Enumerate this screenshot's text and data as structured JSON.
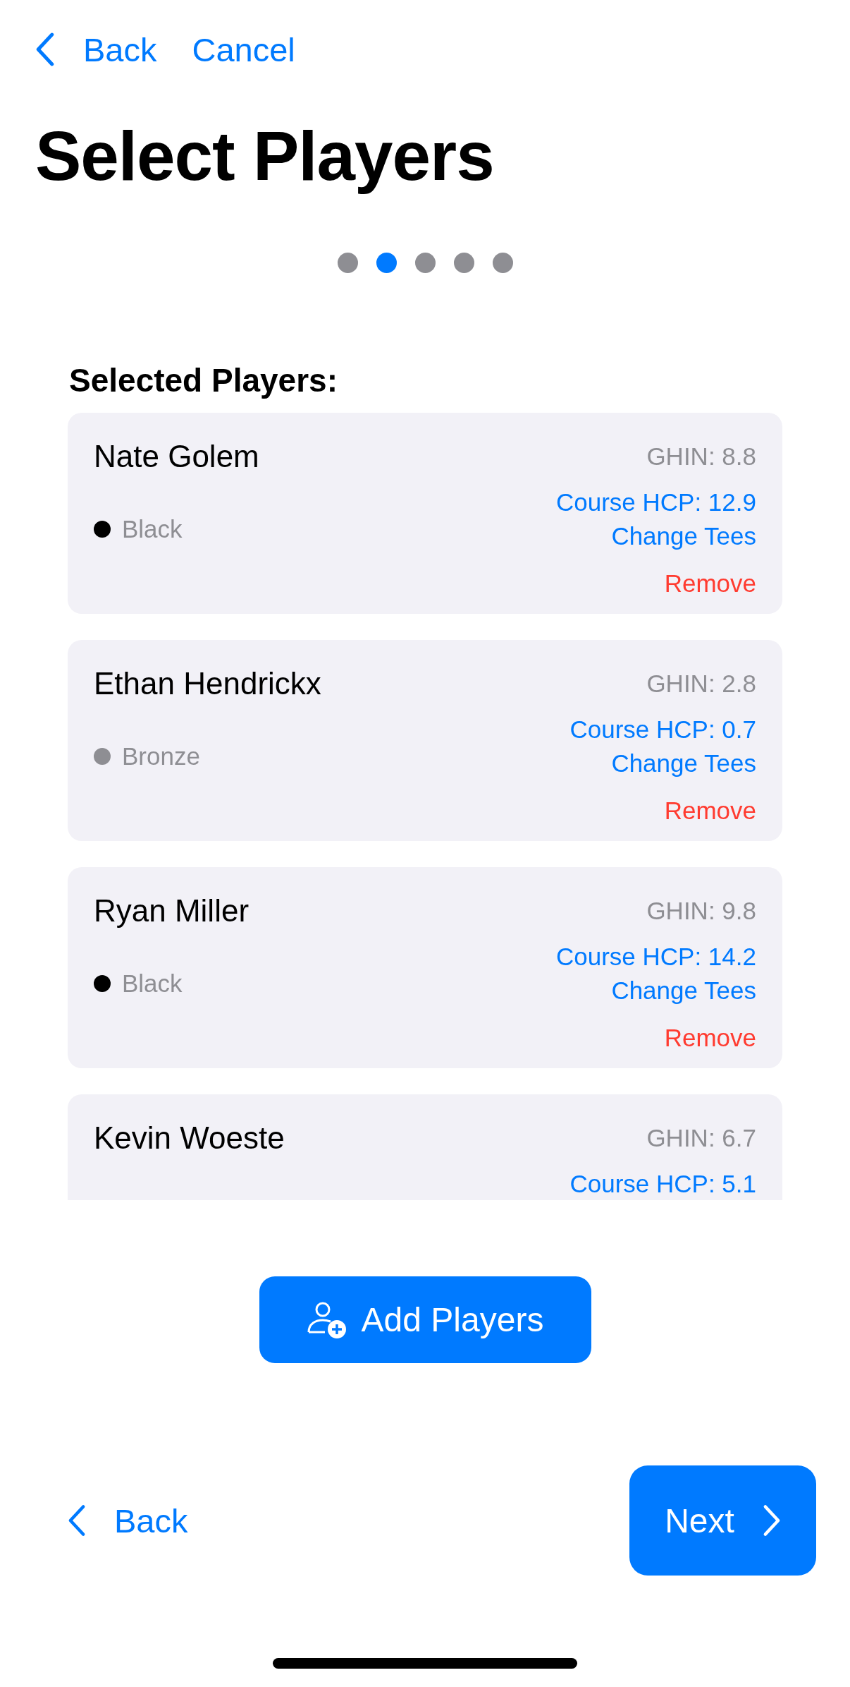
{
  "nav": {
    "back": "Back",
    "cancel": "Cancel"
  },
  "title": "Select Players",
  "steps": [
    {
      "selected": false
    },
    {
      "selected": true
    },
    {
      "selected": false
    },
    {
      "selected": false
    },
    {
      "selected": false
    }
  ],
  "section_title": "Selected Players:",
  "players": [
    {
      "name": "Nate Golem",
      "ghin": "GHIN: 8.8",
      "tee": "Black",
      "color": "#000000",
      "course_hcp": "Course HCP: 12.9",
      "change_tees": "Change Tees",
      "remove": "Remove"
    },
    {
      "name": "Ethan Hendrickx",
      "ghin": "GHIN: 2.8",
      "tee": "Bronze",
      "color": "#8e8e93",
      "course_hcp": "Course HCP: 0.7",
      "change_tees": "Change Tees",
      "remove": "Remove"
    },
    {
      "name": "Ryan Miller",
      "ghin": "GHIN: 9.8",
      "tee": "Black",
      "color": "#000000",
      "course_hcp": "Course HCP: 14.2",
      "change_tees": "Change Tees",
      "remove": "Remove"
    },
    {
      "name": "Kevin Woeste",
      "ghin": "GHIN: 6.7",
      "course_hcp": "Course HCP: 5.1"
    }
  ],
  "add_button": "Add Players",
  "footer": {
    "back": "Back",
    "next": "Next"
  }
}
